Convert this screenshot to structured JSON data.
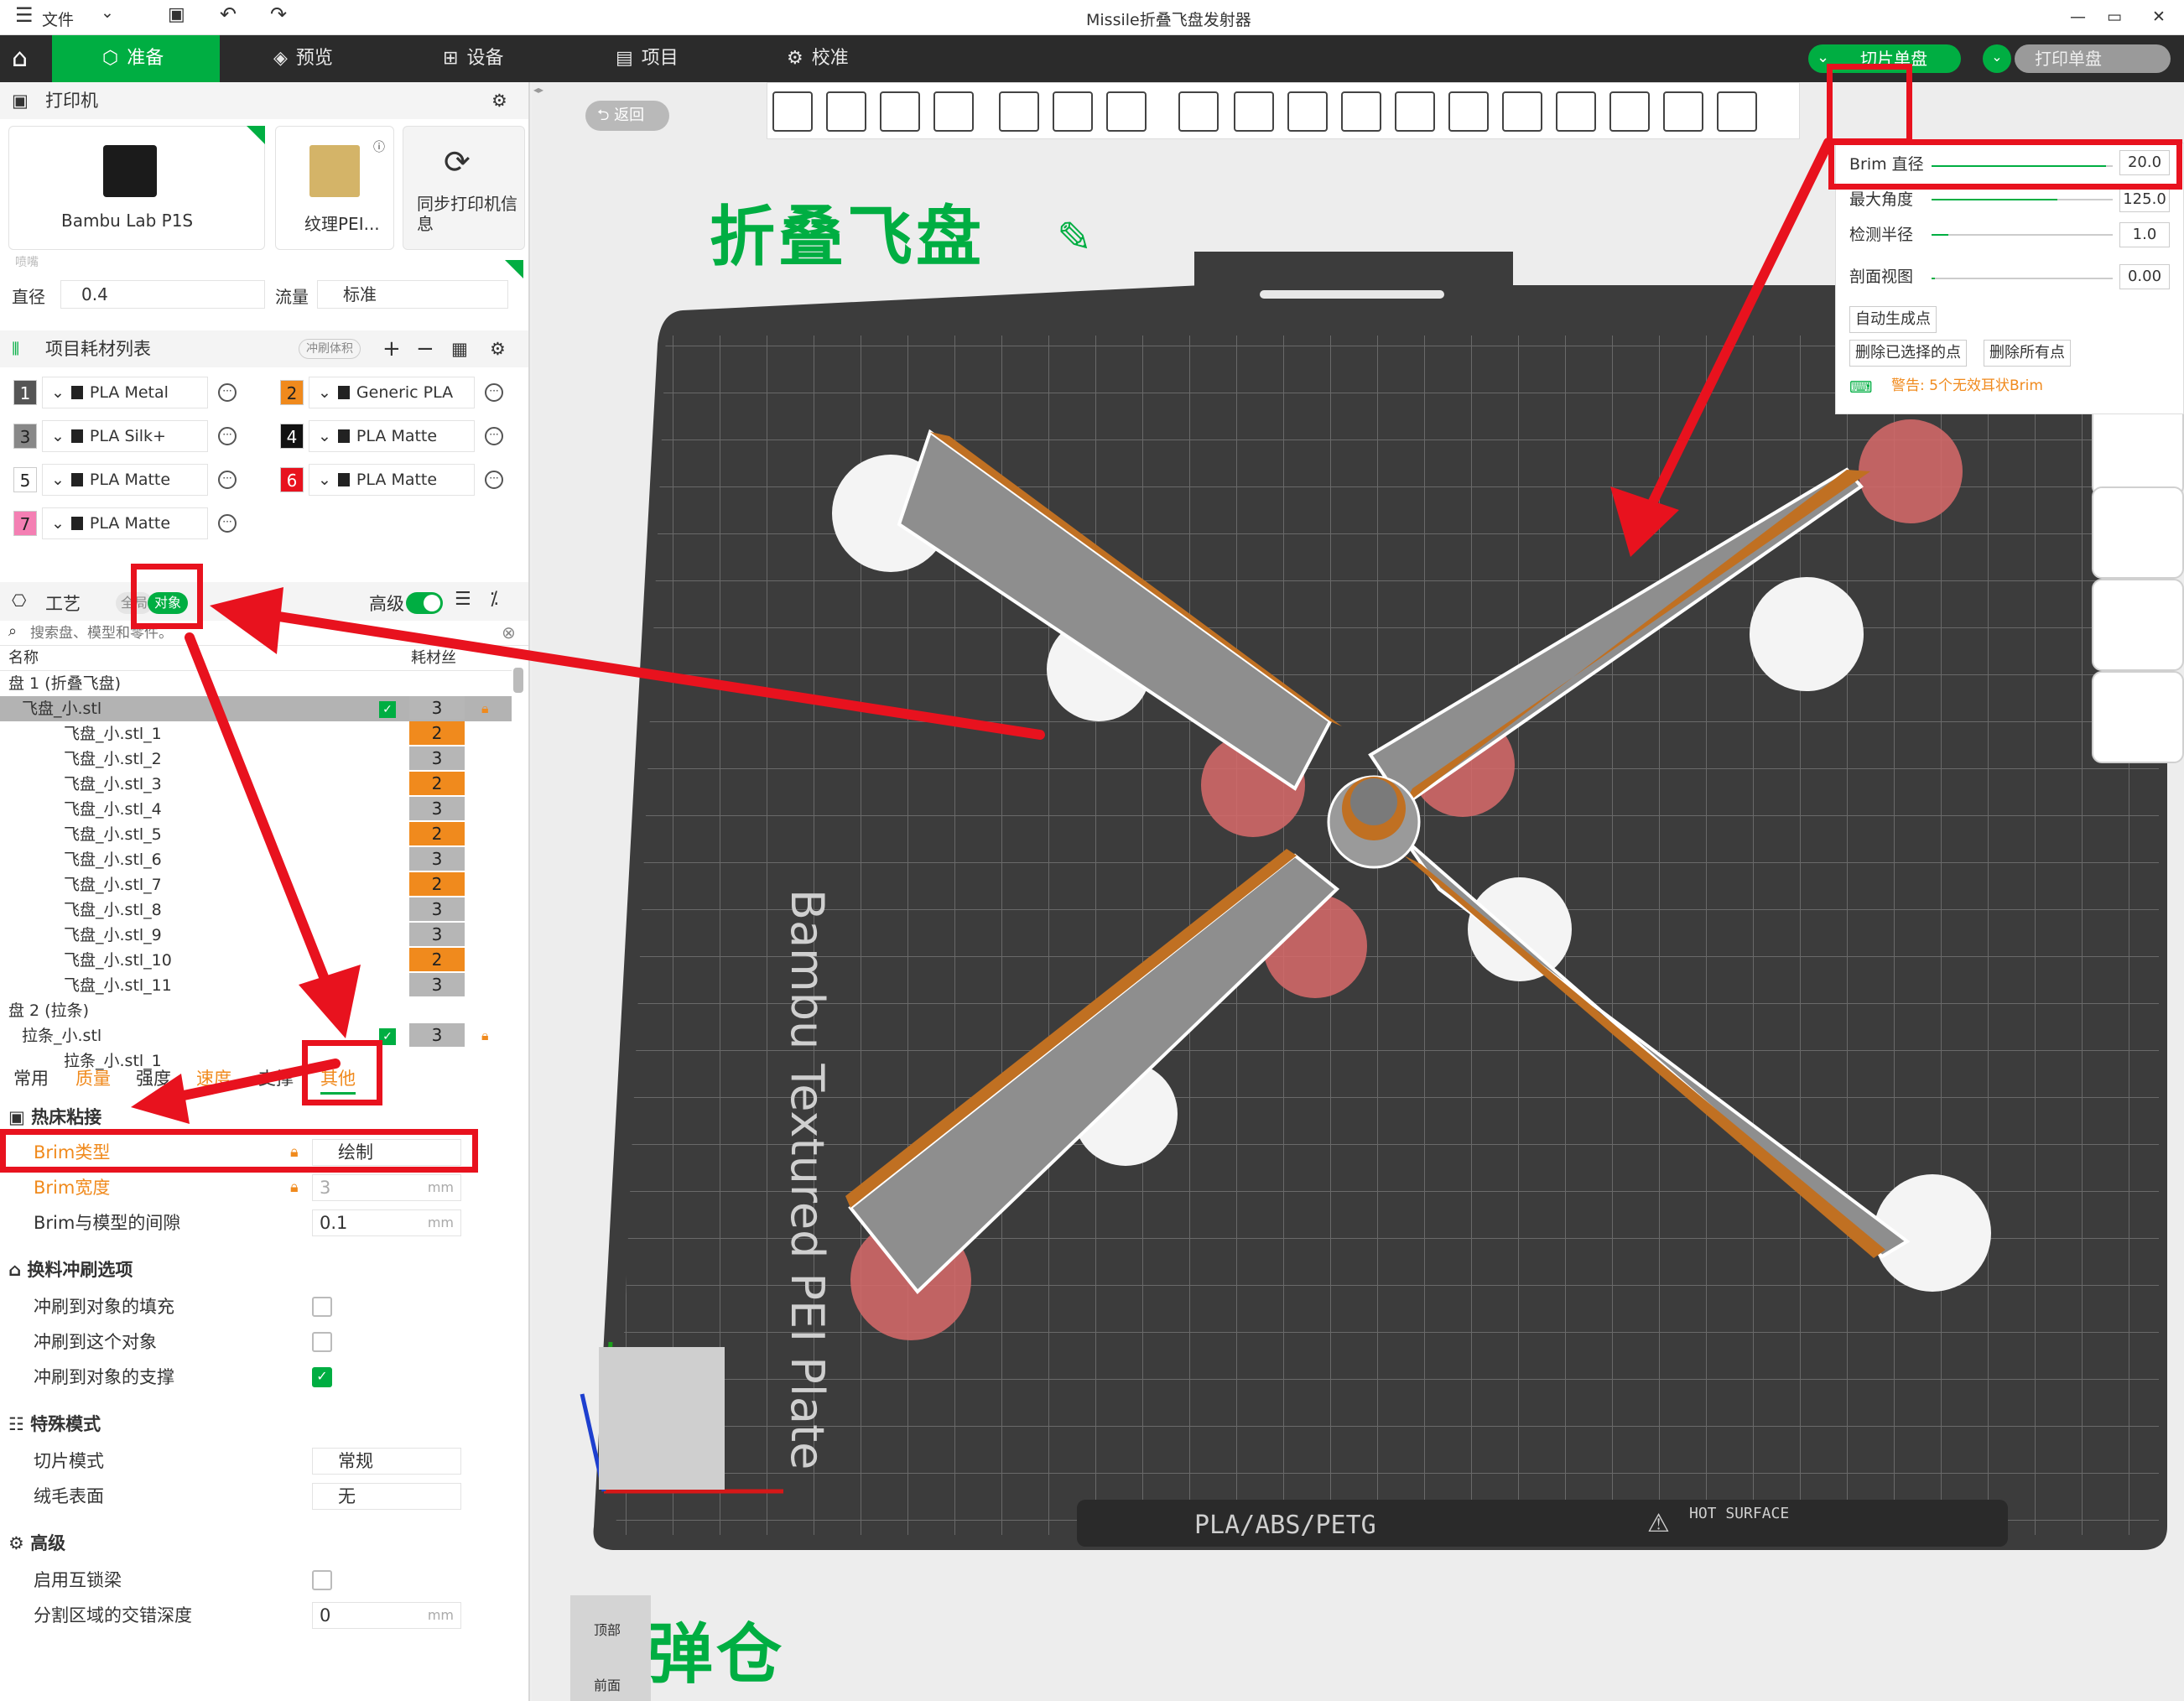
{
  "titlebar": {
    "menu": "文件",
    "title": "Missile折叠飞盘发射器"
  },
  "nav": {
    "tabs": [
      "准备",
      "预览",
      "设备",
      "项目",
      "校准"
    ],
    "slice_button": "切片单盘",
    "print_button": "打印单盘"
  },
  "printer": {
    "header": "打印机",
    "printer_name": "Bambu Lab P1S",
    "plate_name": "纹理PEI...",
    "sync_label": "同步打印机信息",
    "nozzle_label": "喷嘴",
    "diameter_label": "直径",
    "diameter_value": "0.4",
    "flow_label": "流量",
    "flow_value": "标准"
  },
  "filaments": {
    "header": "项目耗材列表",
    "flush_btn": "冲刷体积",
    "items": [
      {
        "num": "1",
        "name": "PLA Metal",
        "color": "#555555"
      },
      {
        "num": "2",
        "name": "Generic PLA",
        "color": "#f08a1d"
      },
      {
        "num": "3",
        "name": "PLA Silk+",
        "color": "#888888"
      },
      {
        "num": "4",
        "name": "PLA Matte",
        "color": "#111111"
      },
      {
        "num": "5",
        "name": "PLA Matte",
        "color": "#ffffff"
      },
      {
        "num": "6",
        "name": "PLA Matte",
        "color": "#e8121e"
      },
      {
        "num": "7",
        "name": "PLA Matte",
        "color": "#f47fb3"
      }
    ]
  },
  "process": {
    "header": "工艺",
    "toggle_all": "全局",
    "toggle_obj": "对象",
    "advanced": "高级",
    "search_placeholder": "搜索盘、模型和零件。",
    "col_name": "名称",
    "col_fil": "耗材丝"
  },
  "tree": {
    "plate1": "盘 1 (折叠飞盘)",
    "obj1": "飞盘_小.stl",
    "obj1_num": "3",
    "parts": [
      {
        "name": "飞盘_小.stl_1",
        "num": "2"
      },
      {
        "name": "飞盘_小.stl_2",
        "num": "3"
      },
      {
        "name": "飞盘_小.stl_3",
        "num": "2"
      },
      {
        "name": "飞盘_小.stl_4",
        "num": "3"
      },
      {
        "name": "飞盘_小.stl_5",
        "num": "2"
      },
      {
        "name": "飞盘_小.stl_6",
        "num": "3"
      },
      {
        "name": "飞盘_小.stl_7",
        "num": "2"
      },
      {
        "name": "飞盘_小.stl_8",
        "num": "3"
      },
      {
        "name": "飞盘_小.stl_9",
        "num": "3"
      },
      {
        "name": "飞盘_小.stl_10",
        "num": "2"
      },
      {
        "name": "飞盘_小.stl_11",
        "num": "3"
      }
    ],
    "plate2": "盘 2 (拉条)",
    "obj2": "拉条_小.stl",
    "obj2_num": "3",
    "obj2_part": "拉条_小.stl_1"
  },
  "tabs": [
    "常用",
    "质量",
    "强度",
    "速度",
    "支撑",
    "其他"
  ],
  "settings": {
    "sec1": "热床粘接",
    "brim_type_label": "Brim类型",
    "brim_type_value": "绘制",
    "brim_width_label": "Brim宽度",
    "brim_width_value": "3",
    "brim_gap_label": "Brim与模型的间隙",
    "brim_gap_value": "0.1",
    "unit_mm": "mm",
    "sec2": "换料冲刷选项",
    "flush_infill": "冲刷到对象的填充",
    "flush_obj": "冲刷到这个对象",
    "flush_support": "冲刷到对象的支撑",
    "sec3": "特殊模式",
    "slice_mode_label": "切片模式",
    "slice_mode_value": "常规",
    "fuzzy_label": "绒毛表面",
    "fuzzy_value": "无",
    "sec4": "高级",
    "interlock_label": "启用互锁梁",
    "interlock_depth_label": "分割区域的交错深度",
    "interlock_depth_value": "0"
  },
  "viewport": {
    "back_btn": "返回",
    "title1": "折叠飞盘",
    "title2": "弹仓",
    "plate_text": "Bambu Textured PEI Plate",
    "plate_footer": "PLA/ABS/PETG",
    "hot_surface": "HOT SURFACE",
    "view_top": "顶部",
    "view_front": "前面"
  },
  "brim_panel": {
    "brim_label": "Brim 直径",
    "brim_value": "20.0",
    "max_angle_label": "最大角度",
    "max_angle_value": "125.0",
    "detect_label": "检测半径",
    "detect_value": "1.0",
    "section_label": "剖面视图",
    "section_value": "0.00",
    "auto_btn": "自动生成点",
    "del_sel_btn": "删除已选择的点",
    "del_all_btn": "删除所有点",
    "warning": "警告: 5个无效耳状Brim"
  }
}
